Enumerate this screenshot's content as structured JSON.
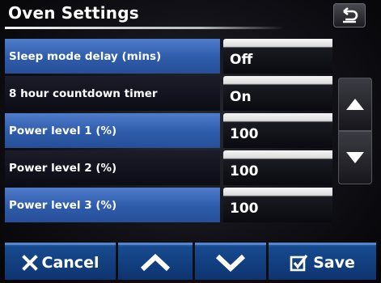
{
  "header": {
    "title": "Oven Settings",
    "back_icon": "return-arrow-icon"
  },
  "settings": [
    {
      "label": "Sleep mode delay (mins)",
      "value": "Off",
      "style": "blue"
    },
    {
      "label": "8 hour countdown timer",
      "value": "On",
      "style": "dark"
    },
    {
      "label": "Power level 1 (%)",
      "value": "100",
      "style": "blue"
    },
    {
      "label": "Power level 2 (%)",
      "value": "100",
      "style": "dark"
    },
    {
      "label": "Power level 3 (%)",
      "value": "100",
      "style": "blue"
    }
  ],
  "scroll": {
    "up_icon": "triangle-up-icon",
    "down_icon": "triangle-down-icon"
  },
  "footer": {
    "cancel_label": "Cancel",
    "cancel_icon": "x-icon",
    "up_icon": "chevron-up-icon",
    "down_icon": "chevron-down-icon",
    "save_label": "Save",
    "save_icon": "checkbox-icon"
  },
  "colors": {
    "row_blue": "#2e5caa",
    "row_dark": "#0c0c16",
    "footer_blue": "#174a8e"
  }
}
